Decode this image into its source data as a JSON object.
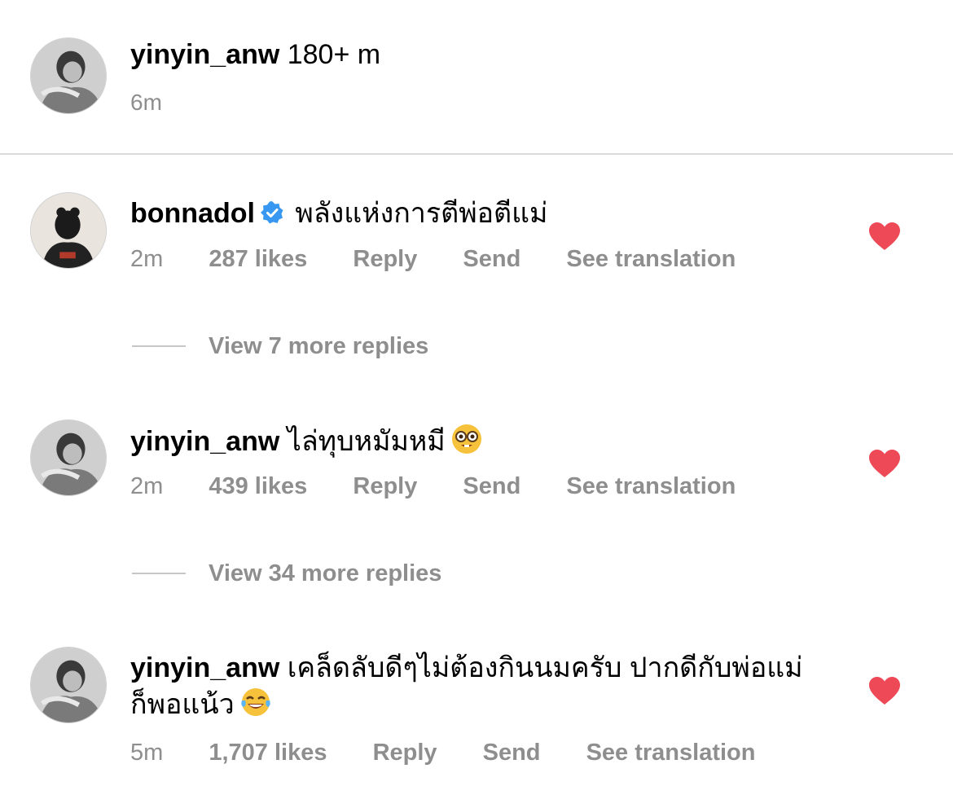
{
  "caption": {
    "username": "yinyin_anw",
    "text": "180+ m",
    "time": "6m"
  },
  "comments": [
    {
      "username": "bonnadol",
      "verified": true,
      "text": "พลังแห่งการตีพ่อตีแม่",
      "time": "2m",
      "likes": "287 likes",
      "reply_label": "Reply",
      "send_label": "Send",
      "translation_label": "See translation",
      "liked": true,
      "view_replies": "View 7 more replies"
    },
    {
      "username": "yinyin_anw",
      "verified": false,
      "text": "ไล่ทุบหมัมหมี",
      "emoji": "nerd-face",
      "time": "2m",
      "likes": "439 likes",
      "reply_label": "Reply",
      "send_label": "Send",
      "translation_label": "See translation",
      "liked": true,
      "view_replies": "View 34 more replies"
    },
    {
      "username": "yinyin_anw",
      "verified": false,
      "text": "เคล็ดลับดีๆไม่ต้องกินนมครับ ปากดีกับพ่อแม่ก็พอแน้ว",
      "emoji": "tears-of-joy",
      "time": "5m",
      "likes": "1,707 likes",
      "reply_label": "Reply",
      "send_label": "Send",
      "translation_label": "See translation",
      "liked": true
    }
  ],
  "colors": {
    "heart": "#ed4956",
    "secondary_text": "#8e8e8e",
    "verified": "#3897f0",
    "divider": "#dbdbdb"
  }
}
